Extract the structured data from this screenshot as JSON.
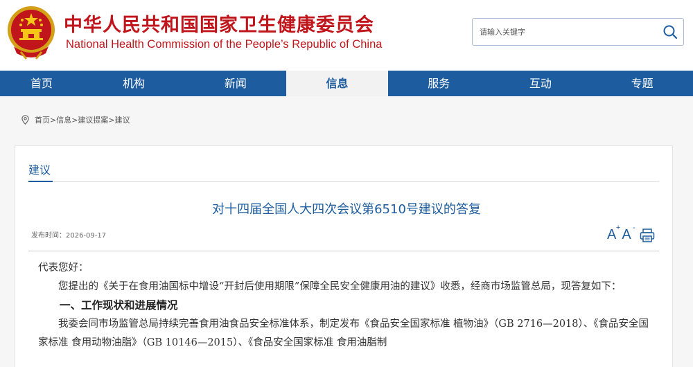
{
  "header": {
    "title_cn": "中华人民共和国国家卫生健康委员会",
    "title_en": "National Health Commission of the People’s  Republic of China",
    "brand_color": "#c0151b",
    "emblem_icon": "national-emblem-icon"
  },
  "search": {
    "placeholder": "请输入关键字",
    "button_icon": "search-icon"
  },
  "nav": {
    "color": "#1d5c9e",
    "items": [
      {
        "label": "首页",
        "active": false
      },
      {
        "label": "机构",
        "active": false
      },
      {
        "label": "新闻",
        "active": false
      },
      {
        "label": "信息",
        "active": true
      },
      {
        "label": "服务",
        "active": false
      },
      {
        "label": "互动",
        "active": false
      },
      {
        "label": "专题",
        "active": false
      }
    ]
  },
  "breadcrumb": {
    "icon": "location-pin-icon",
    "text": "首页>信息>建议提案>建议"
  },
  "section": {
    "title": "建议"
  },
  "article": {
    "title": "对十四届全国人大四次会议第6510号建议的答复",
    "pub_label": "发布时间：",
    "pub_date": "2026-09-17",
    "tools": {
      "font_larger": "A",
      "font_smaller": "A",
      "print_icon": "print-icon"
    },
    "paragraphs": {
      "greeting": "代表您好：",
      "p1": "您提出的《关于在食用油国标中增设“开封后使用期限”保障全民安全健康用油的建议》收悉，经商市场监管总局，现答复如下：",
      "h1": "一、工作现状和进展情况",
      "p2": "我委会同市场监管总局持续完善食用油食品安全标准体系，制定发布《食品安全国家标准 植物油》（GB 2716—2018）、《食品安全国家标准 食用动物油脂》（GB 10146—2015）、《食品安全国家标准 食用油脂制"
    }
  }
}
